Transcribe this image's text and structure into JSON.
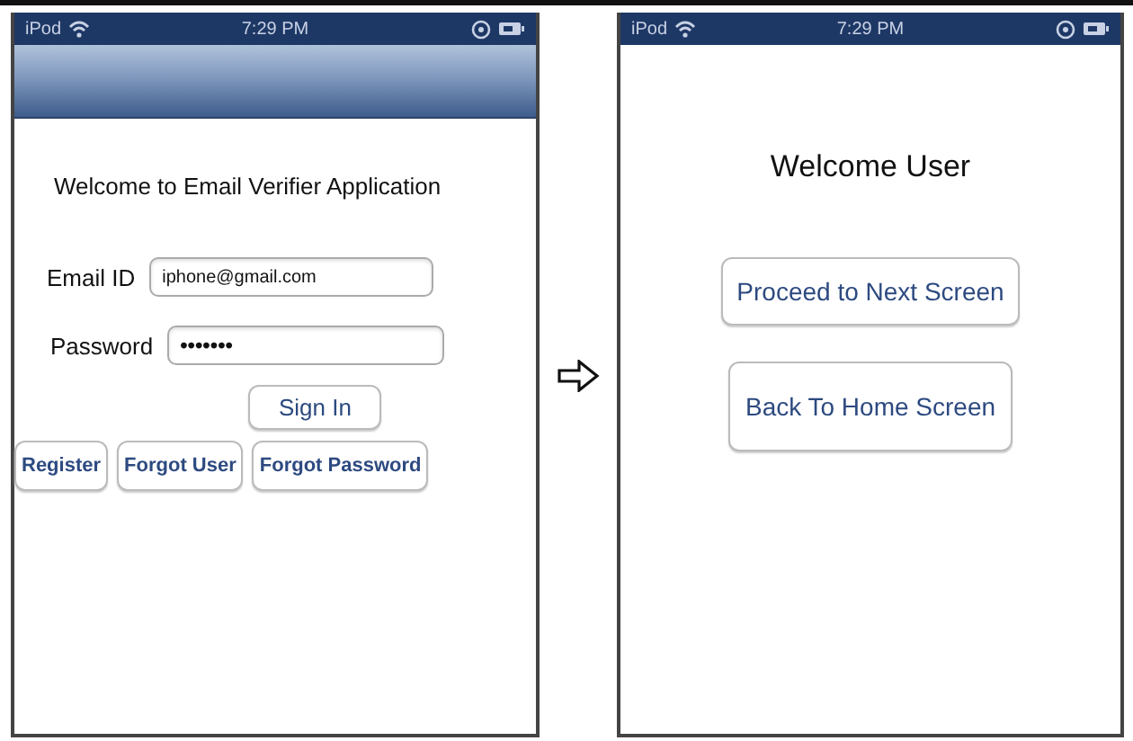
{
  "screens": [
    {
      "kind": "login",
      "status_bar": {
        "carrier": "iPod",
        "time": "7:29 PM"
      },
      "nav_bar": true,
      "title": "Welcome to Email Verifier Application",
      "fields": [
        {
          "label": "Email ID",
          "value": "iphone@gmail.com"
        },
        {
          "label": "Password",
          "value": "•••••••"
        }
      ],
      "primary_button": "Sign In",
      "buttons": [
        "Register",
        "Forgot User",
        "Forgot Password"
      ]
    },
    {
      "kind": "welcome",
      "status_bar": {
        "carrier": "iPod",
        "time": "7:29 PM"
      },
      "nav_bar": false,
      "title": "Welcome User",
      "buttons": [
        "Proceed to Next Screen",
        "Back To Home Screen"
      ]
    }
  ]
}
